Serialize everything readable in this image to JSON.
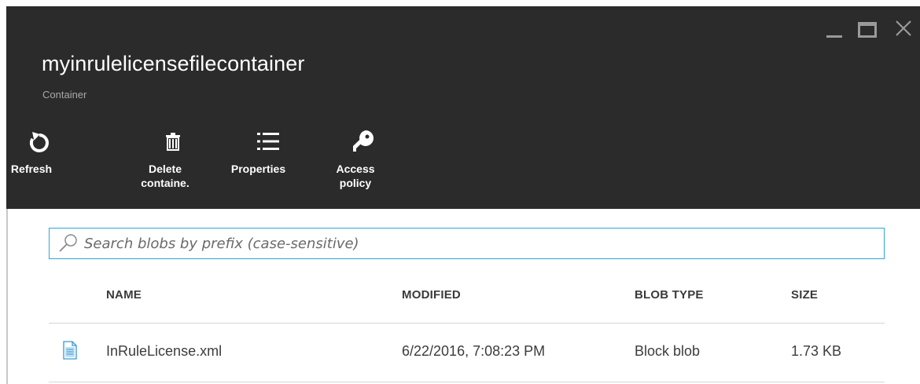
{
  "window": {
    "title": "myinrulelicensefilecontainer",
    "subtitle": "Container"
  },
  "toolbar": {
    "commands": [
      {
        "label": "Refresh",
        "icon": "refresh-icon"
      },
      {
        "label": "Delete\ncontaine.",
        "icon": "trash-icon"
      },
      {
        "label": "Properties",
        "icon": "list-icon"
      },
      {
        "label": "Access\npolicy",
        "icon": "key-icon"
      }
    ]
  },
  "search": {
    "placeholder": "Search blobs by prefix (case-sensitive)",
    "value": "",
    "icon": "search-icon"
  },
  "table": {
    "columns": [
      "NAME",
      "MODIFIED",
      "BLOB TYPE",
      "SIZE"
    ],
    "rows": [
      {
        "icon": "document-icon",
        "name": "InRuleLicense.xml",
        "modified": "6/22/2016, 7:08:23 PM",
        "blob_type": "Block blob",
        "size": "1.73 KB"
      }
    ]
  },
  "colors": {
    "header_bg": "#2b2b2b",
    "accent": "#2ea7d6",
    "header_text": "#ffffff",
    "subtitle_text": "#a8a8a8"
  }
}
